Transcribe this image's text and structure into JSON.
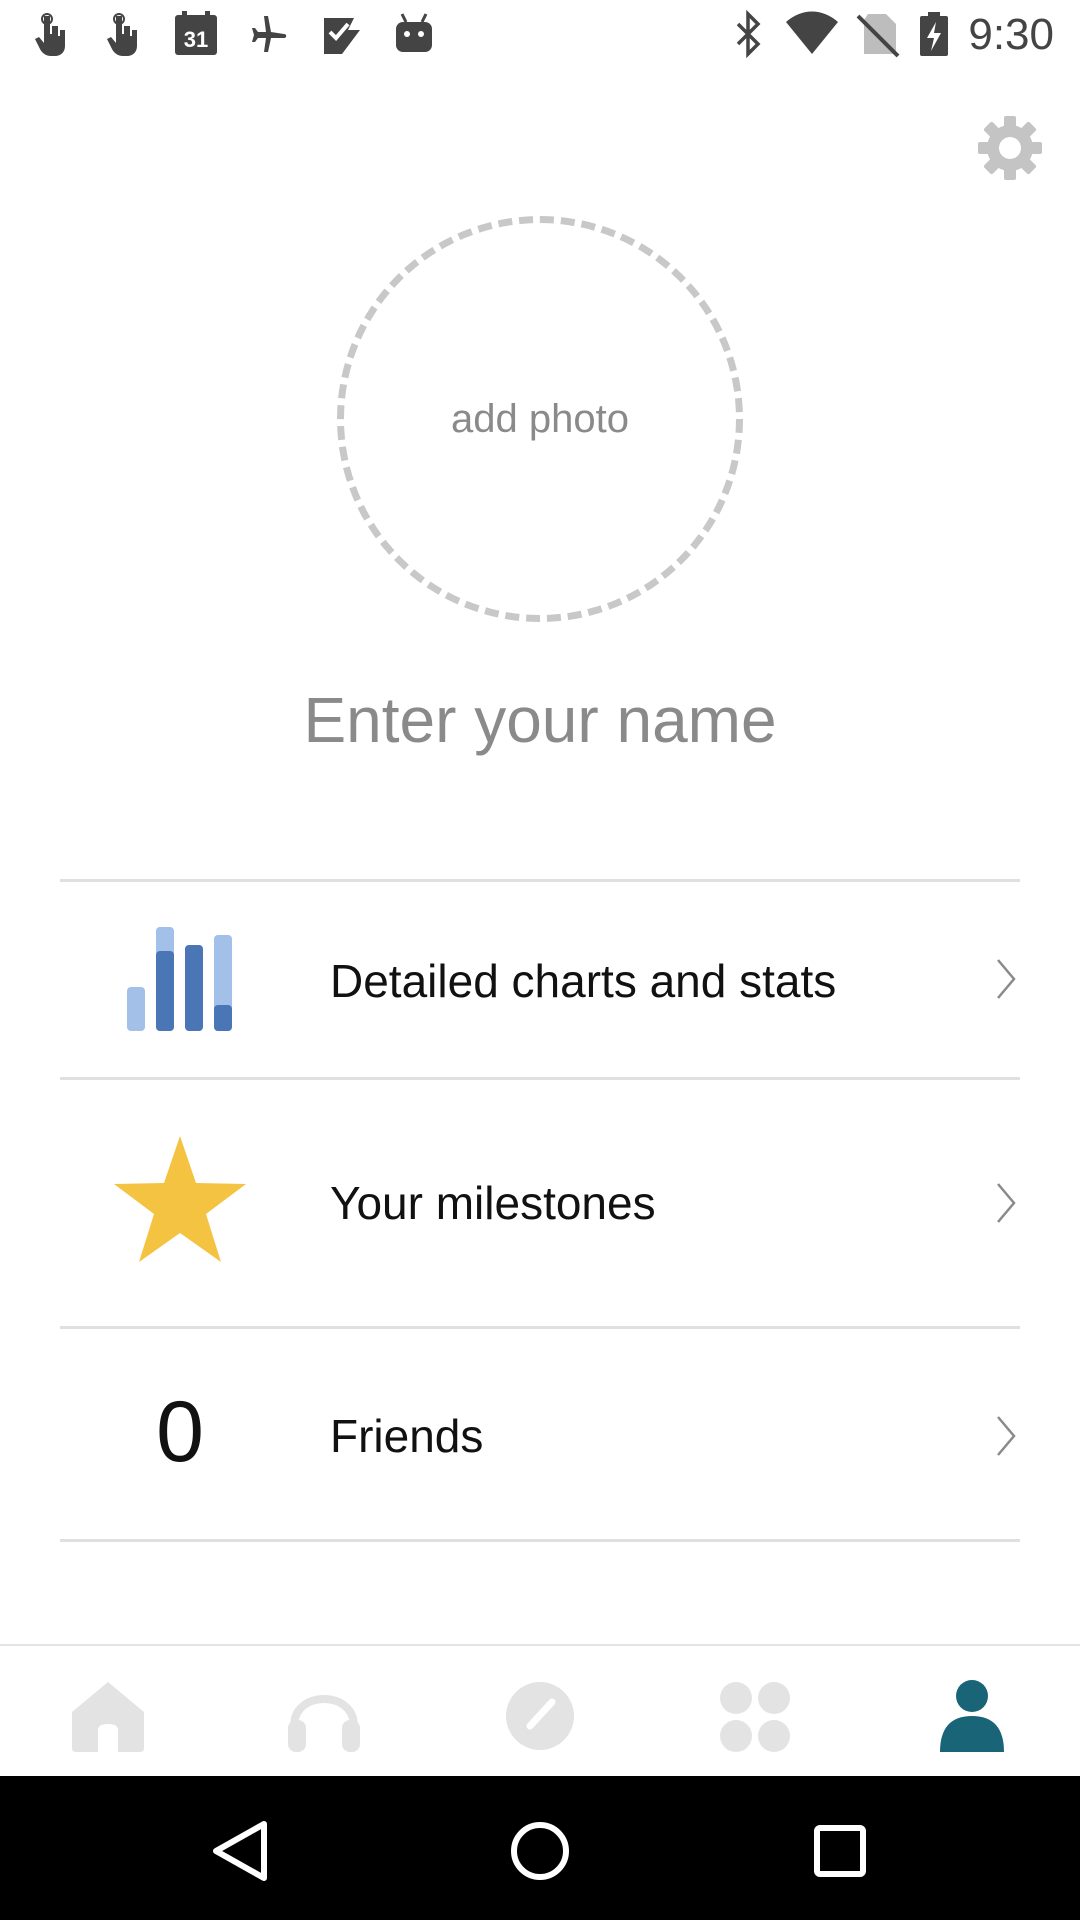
{
  "status_bar": {
    "time": "9:30",
    "left_icons": [
      "touch-icon",
      "touch-icon",
      "calendar-icon",
      "airplane-icon",
      "check-icon",
      "android-icon"
    ],
    "calendar_day": "31",
    "right_icons": [
      "bluetooth-icon",
      "wifi-icon",
      "no-sim-icon",
      "battery-charging-icon"
    ]
  },
  "profile": {
    "add_photo_label": "add photo",
    "name_placeholder": "Enter your name"
  },
  "menu": {
    "charts_label": "Detailed charts and stats",
    "milestones_label": "Your milestones",
    "friends_label": "Friends",
    "friends_count": "0"
  },
  "bottom_nav": {
    "items": [
      "home-icon",
      "headphones-icon",
      "speedometer-icon",
      "grid-icon",
      "profile-icon"
    ],
    "active": "profile-icon"
  },
  "colors": {
    "accent": "#1a6478",
    "star": "#f5c342",
    "bar_dark": "#4a76b5",
    "bar_light": "#a3c0e8",
    "inactive_icon": "#e3e3e3"
  }
}
